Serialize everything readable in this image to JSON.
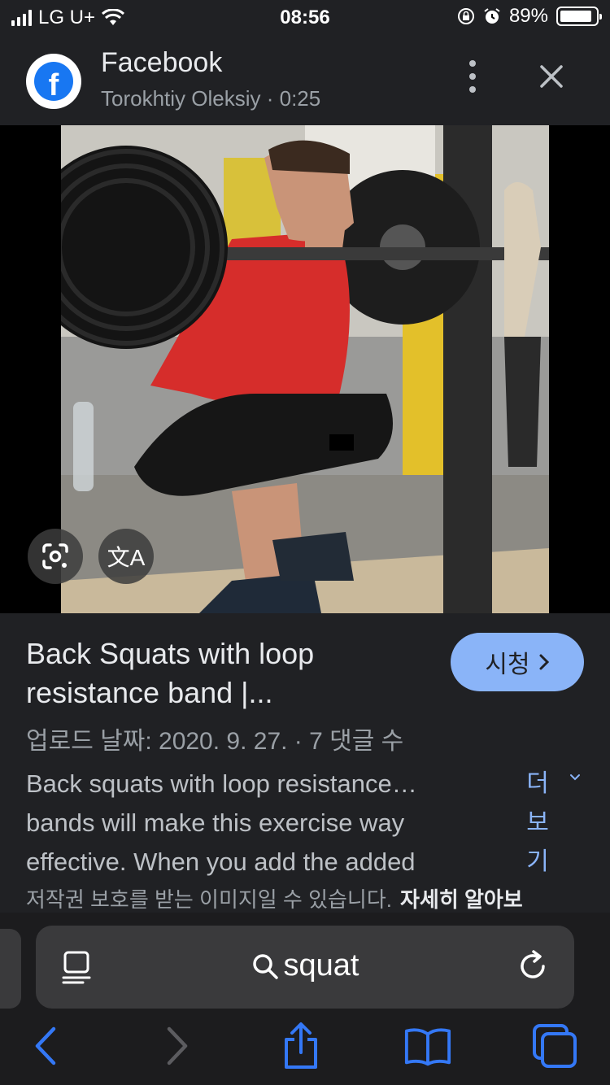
{
  "status_bar": {
    "carrier": "LG U+",
    "time": "08:56",
    "battery": "89%"
  },
  "header": {
    "source": "Facebook",
    "subtitle": "Torokhtiy Oleksiy · 0:25",
    "logo_letter": "f"
  },
  "result": {
    "title": "Back Squats with loop resistance band |...",
    "watch_label": "시청",
    "meta": "업로드 날짜: 2020. 9. 27. · 7 댓글 수",
    "description": "Back squats with loop resistance… bands will make this exercise way effective. When you add the added",
    "more_label": "더보기",
    "copyright": "저작권 보호를 받는 이미지일 수 있습니다.",
    "learn_more": "자세히 알아보"
  },
  "overlay_buttons": {
    "translate_glyph": "文A"
  },
  "address_bar": {
    "query": "squat"
  },
  "colors": {
    "accent": "#8ab4f8",
    "facebook_blue": "#1877f2",
    "background": "#202124"
  },
  "icons": [
    "signal-icon",
    "wifi-icon",
    "lock-rotation-icon",
    "alarm-icon",
    "battery-icon",
    "more-vert-icon",
    "close-icon",
    "lens-icon",
    "translate-icon",
    "chevron-right-icon",
    "chevron-down-icon",
    "reader-icon",
    "search-icon",
    "reload-icon",
    "back-icon",
    "forward-icon",
    "share-icon",
    "bookmarks-icon",
    "tabs-icon"
  ]
}
